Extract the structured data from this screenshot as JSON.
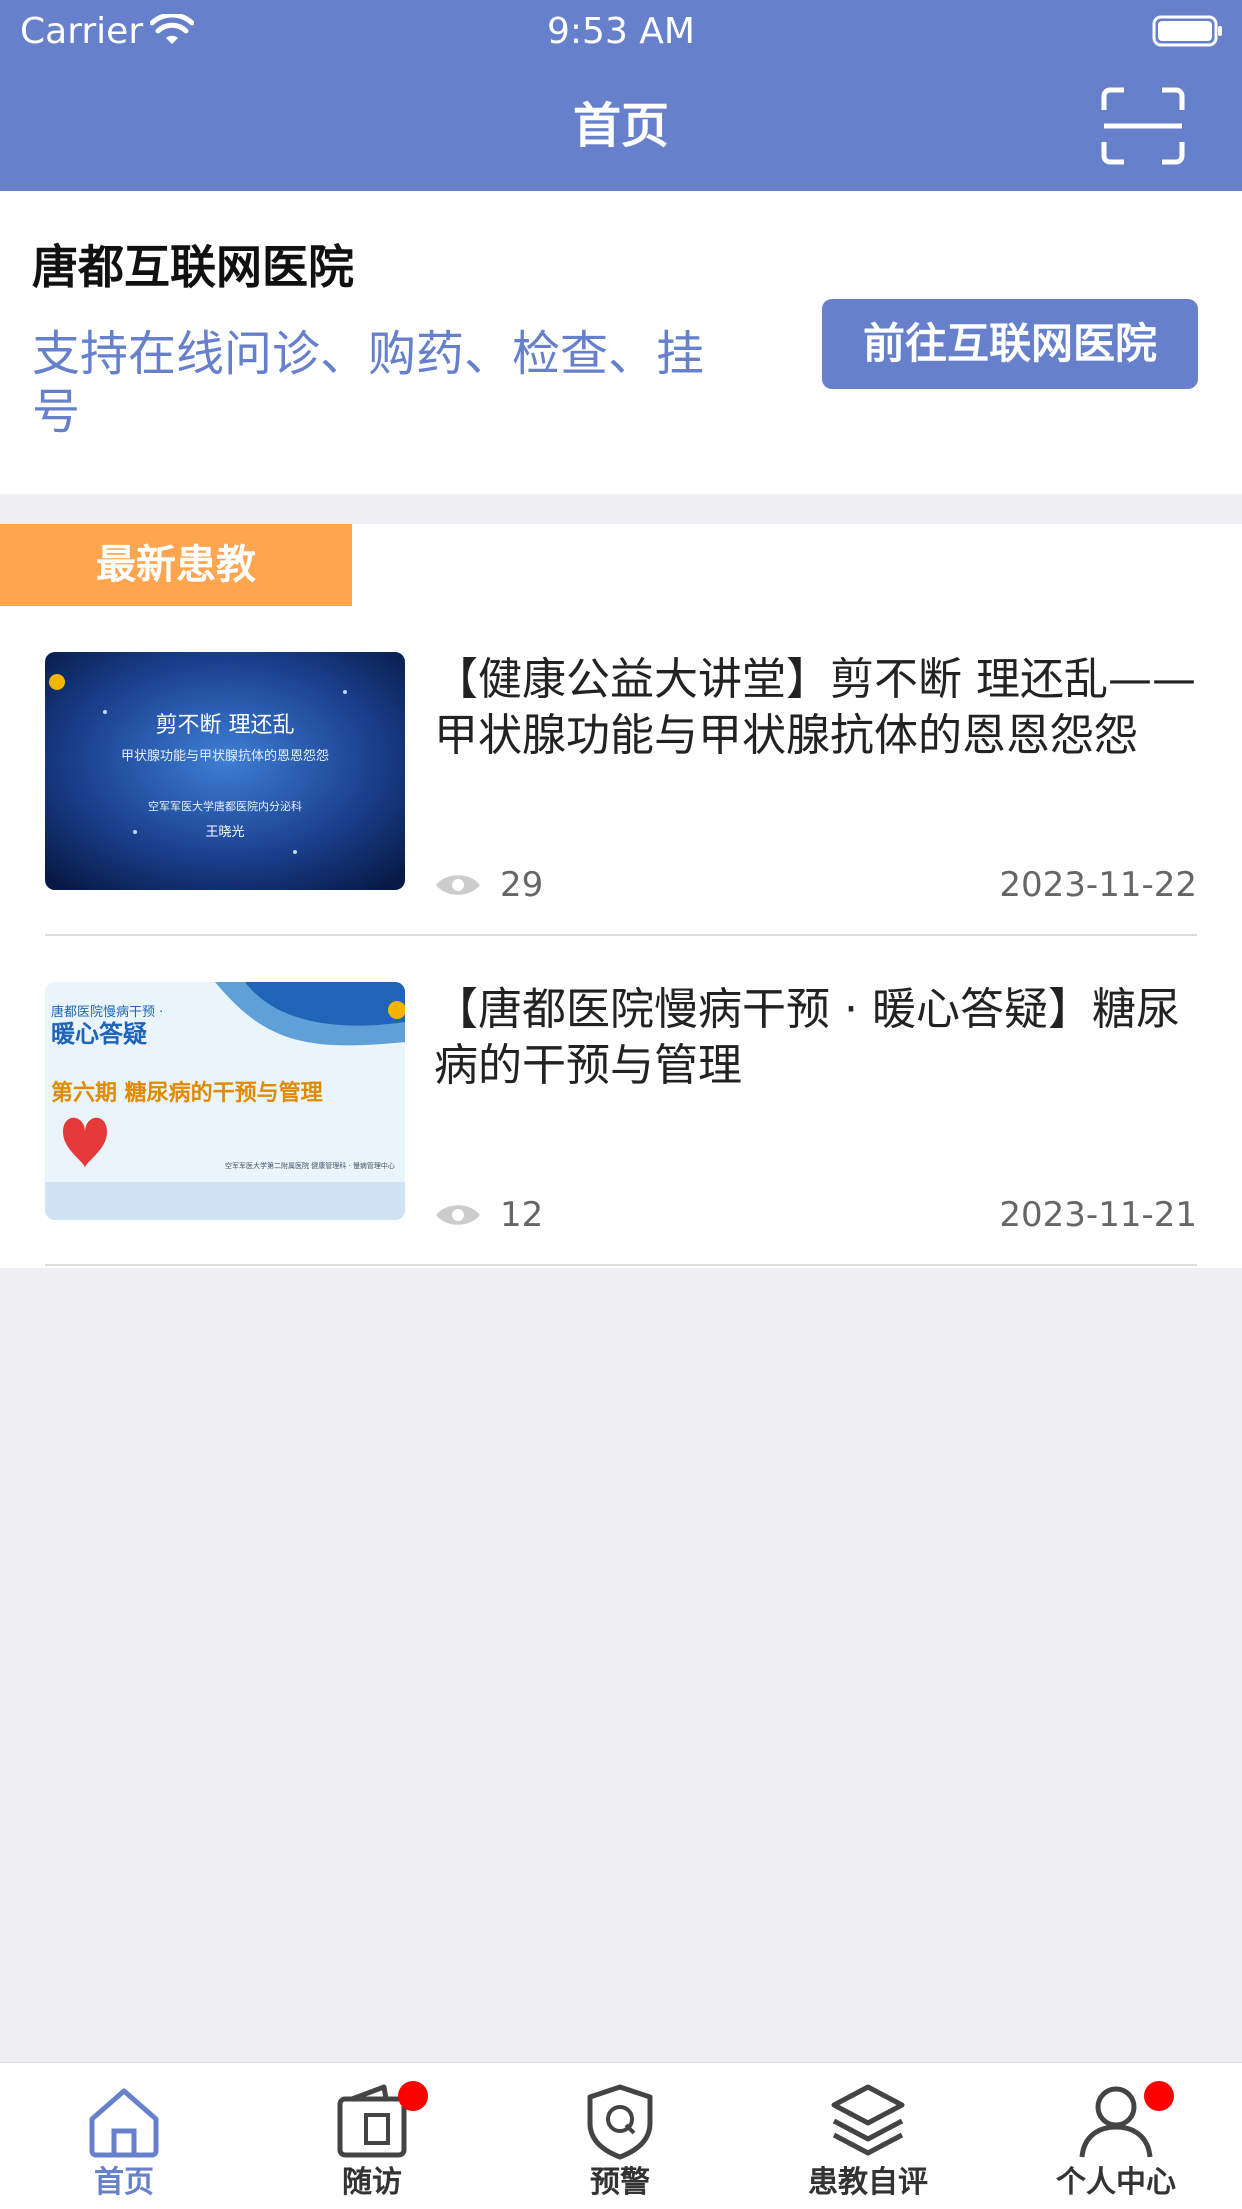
{
  "status_bar": {
    "carrier": "Carrier",
    "time": "9:53 AM"
  },
  "nav": {
    "title": "首页",
    "scan_icon": "scan-icon"
  },
  "hospital": {
    "name": "唐都互联网医院",
    "description": "支持在线问诊、购药、检查、挂号",
    "button": "前往互联网医院"
  },
  "section": {
    "tag": "最新患教"
  },
  "articles": [
    {
      "title": "【健康公益大讲堂】剪不断 理还乱——甲状腺功能与甲状腺抗体的恩恩怨怨",
      "views": "29",
      "date": "2023-11-22",
      "thumb": {
        "line1": "剪不断 理还乱",
        "line2": "甲状腺功能与甲状腺抗体的恩恩怨怨",
        "line3": "空军军医大学唐都医院内分泌科",
        "line4": "王晓光"
      }
    },
    {
      "title": "【唐都医院慢病干预 · 暖心答疑】糖尿病的干预与管理",
      "views": "12",
      "date": "2023-11-21",
      "thumb": {
        "line1": "唐都医院慢病干预 ·",
        "line2": "暖心答疑",
        "line3": "第六期  糖尿病的干预与管理",
        "line4": "空军军医大学第二附属医院    健康管理科 · 慢病管理中心"
      }
    }
  ],
  "tabs": [
    {
      "label": "首页",
      "icon": "home-icon",
      "active": true,
      "badge": false
    },
    {
      "label": "随访",
      "icon": "follow-up-icon",
      "active": false,
      "badge": true
    },
    {
      "label": "预警",
      "icon": "warning-shield-icon",
      "active": false,
      "badge": false
    },
    {
      "label": "患教自评",
      "icon": "layers-icon",
      "active": false,
      "badge": false
    },
    {
      "label": "个人中心",
      "icon": "person-icon",
      "active": false,
      "badge": true
    }
  ],
  "colors": {
    "primary": "#6680cc",
    "accent": "#ffa550",
    "badge": "#ff0000"
  }
}
